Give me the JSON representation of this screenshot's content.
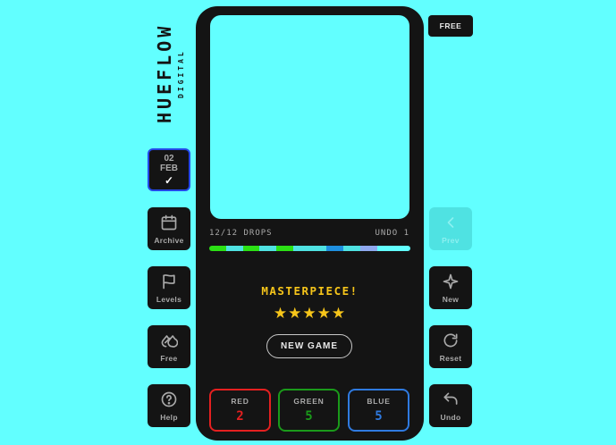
{
  "brand": {
    "name": "HUEFLOW",
    "sub": "DIGITAL"
  },
  "badge": {
    "label": "FREE"
  },
  "date": {
    "day": "02",
    "month": "FEB",
    "check": "✓"
  },
  "left_nav": [
    {
      "label": "Archive",
      "icon": "calendar-icon"
    },
    {
      "label": "Levels",
      "icon": "flag-icon"
    },
    {
      "label": "Free",
      "icon": "droplets-icon"
    },
    {
      "label": "Help",
      "icon": "help-circle-icon"
    }
  ],
  "right_nav": [
    {
      "label": "Prev",
      "icon": "chevron-left-icon",
      "disabled": true
    },
    {
      "label": "New",
      "icon": "sparkle-icon"
    },
    {
      "label": "Reset",
      "icon": "refresh-icon"
    },
    {
      "label": "Undo",
      "icon": "undo-icon"
    }
  ],
  "game": {
    "drops": "12/12 DROPS",
    "undo": "UNDO 1",
    "canvas_color": "#62ffff",
    "history_colors": [
      "#2ce015",
      "#4fe2e2",
      "#2ce015",
      "#4fe2e2",
      "#2ce015",
      "#4fe2e2",
      "#4fe2e2",
      "#1e8fdf",
      "#4fe2e2",
      "#8fa8ef",
      "#62ffff",
      "#62ffff"
    ],
    "result": "MASTERPIECE!",
    "stars": "★★★★★",
    "rating": 5,
    "new_game": "NEW GAME"
  },
  "colors": [
    {
      "name": "RED",
      "value": "2",
      "color": "#e52020"
    },
    {
      "name": "GREEN",
      "value": "5",
      "color": "#1a9a1a"
    },
    {
      "name": "BLUE",
      "value": "5",
      "color": "#2f7ae0"
    }
  ]
}
